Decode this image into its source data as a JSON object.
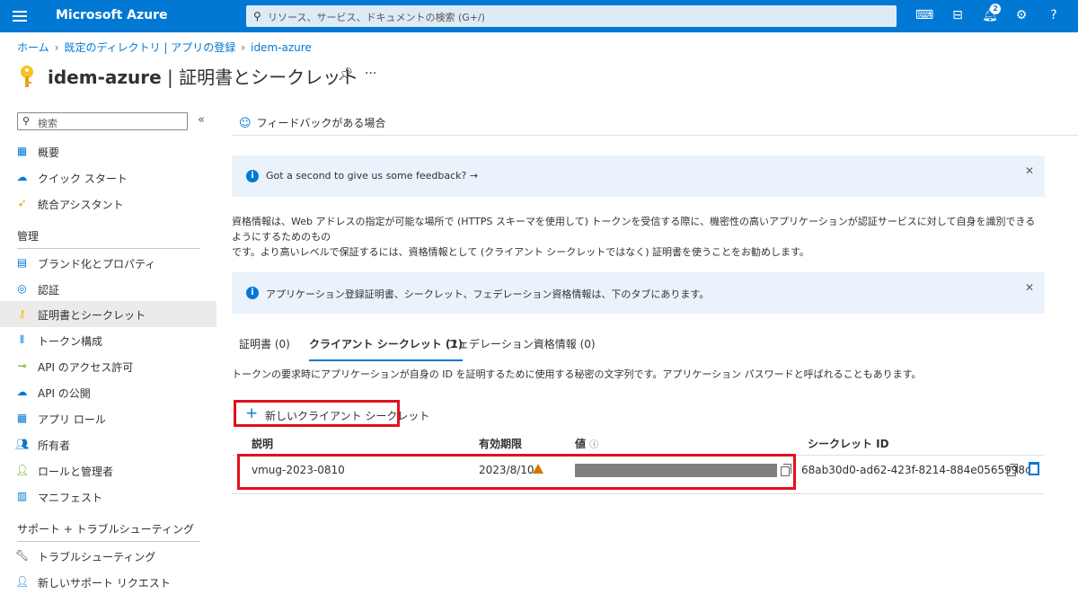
{
  "topbar": {
    "brand": "Microsoft Azure",
    "search_placeholder": "リソース、サービス、ドキュメントの検索 (G+/)",
    "notification_count": "2",
    "color": "#0078d4"
  },
  "breadcrumb": {
    "items": [
      "ホーム",
      "既定のディレクトリ | アプリの登録",
      "idem-azure"
    ]
  },
  "header": {
    "title_app": "idem-azure",
    "title_sep": " | ",
    "title_page": "証明書とシークレット",
    "more": "···"
  },
  "sidebar": {
    "search_placeholder": "検索",
    "collapse": "«",
    "items": [
      {
        "label": "概要",
        "icon": "overview-icon"
      },
      {
        "label": "クイック スタート",
        "icon": "quickstart-icon"
      },
      {
        "label": "統合アシスタント",
        "icon": "rocket-icon"
      }
    ],
    "section_manage": "管理",
    "manage_items": [
      {
        "label": "ブランド化とプロパティ",
        "icon": "branding-icon"
      },
      {
        "label": "認証",
        "icon": "auth-icon"
      },
      {
        "label": "証明書とシークレット",
        "icon": "key-icon"
      },
      {
        "label": "トークン構成",
        "icon": "token-icon"
      },
      {
        "label": "API のアクセス許可",
        "icon": "api-permission-icon"
      },
      {
        "label": "API の公開",
        "icon": "cloud-icon"
      },
      {
        "label": "アプリ ロール",
        "icon": "app-roles-icon"
      },
      {
        "label": "所有者",
        "icon": "owners-icon"
      },
      {
        "label": "ロールと管理者",
        "icon": "roles-admins-icon"
      },
      {
        "label": "マニフェスト",
        "icon": "manifest-icon"
      }
    ],
    "section_support": "サポート + トラブルシューティング",
    "support_items": [
      {
        "label": "トラブルシューティング",
        "icon": "wrench-icon"
      },
      {
        "label": "新しいサポート リクエスト",
        "icon": "support-icon"
      }
    ]
  },
  "main": {
    "feedback_link": "フィードバックがある場合",
    "info1": "Got a second to give us some feedback? →",
    "description_line1": "資格情報は、Web アドレスの指定が可能な場所で (HTTPS スキーマを使用して) トークンを受信する際に、機密性の高いアプリケーションが認証サービスに対して自身を識別できるようにするためのもの",
    "description_line2": "です。より高いレベルで保証するには、資格情報として (クライアント シークレットではなく) 証明書を使うことをお勧めします。",
    "info2": "アプリケーション登録証明書、シークレット、フェデレーション資格情報は、下のタブにあります。",
    "tabs": [
      "証明書 (0)",
      "クライアント シークレット (1)",
      "フェデレーション資格情報 (0)"
    ],
    "tab_description": "トークンの要求時にアプリケーションが自身の ID を証明するために使用する秘密の文字列です。アプリケーション パスワードと呼ばれることもあります。",
    "new_secret_button": "新しいクライアント シークレット",
    "table": {
      "headers": [
        "説明",
        "有効期限",
        "値",
        "シークレット ID"
      ],
      "rows": [
        {
          "description": "vmug-2023-0810",
          "expires": "2023/8/10",
          "value": "",
          "secret_id": "68ab30d0-ad62-423f-8214-884e0565998c"
        }
      ]
    }
  }
}
